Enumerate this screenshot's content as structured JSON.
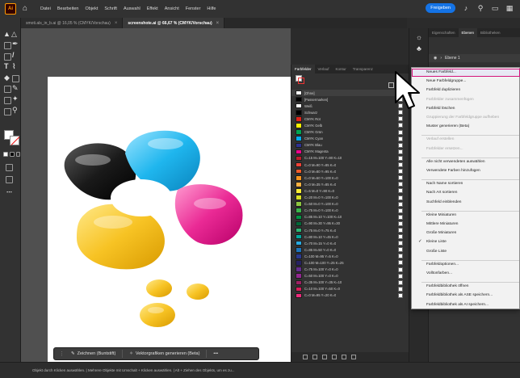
{
  "menubar": {
    "logo": "Ai",
    "items": [
      "Datei",
      "Bearbeiten",
      "Objekt",
      "Schrift",
      "Auswahl",
      "Effekt",
      "Ansicht",
      "Fenster",
      "Hilfe"
    ],
    "share_label": "Freigeben"
  },
  "doc_tabs": [
    {
      "label": "smoti.als_in_b.ai @ 16,05 % (CMYK/Vorschau)",
      "active": false
    },
    {
      "label": "screenshote.ai @ 66,67 % (CMYK/Vorschau)",
      "active": true
    }
  ],
  "swatches_panel": {
    "tabs": [
      "Farbfelder",
      "Verlauf",
      "Kontur",
      "Transparenz"
    ],
    "items": [
      {
        "name": "[Ohne]",
        "color": "#ffffff"
      },
      {
        "name": "[Passermarken]",
        "color": "#000000"
      },
      {
        "name": "Weiß",
        "color": "#ffffff"
      },
      {
        "name": "Schwarz",
        "color": "#000000"
      },
      {
        "name": "CMYK Rot",
        "color": "#e2231a"
      },
      {
        "name": "CMYK Gelb",
        "color": "#fff200"
      },
      {
        "name": "CMYK Grün",
        "color": "#00a651"
      },
      {
        "name": "CMYK Cyan",
        "color": "#00aeef"
      },
      {
        "name": "CMYK Blau",
        "color": "#2e3192"
      },
      {
        "name": "CMYK Magenta",
        "color": "#ec008c"
      },
      {
        "name": "C=15 M=100 Y=90 K=10",
        "color": "#be1e2d"
      },
      {
        "name": "C=0 M=90 Y=85 K=0",
        "color": "#ef4136"
      },
      {
        "name": "C=0 M=80 Y=95 K=0",
        "color": "#f15a29"
      },
      {
        "name": "C=0 M=50 Y=100 K=0",
        "color": "#f7941d"
      },
      {
        "name": "C=0 M=35 Y=85 K=0",
        "color": "#fbb040"
      },
      {
        "name": "C=5 M=0 Y=90 K=0",
        "color": "#f9ed32"
      },
      {
        "name": "C=20 M=0 Y=100 K=0",
        "color": "#d7df23"
      },
      {
        "name": "C=50 M=0 Y=100 K=0",
        "color": "#8dc63f"
      },
      {
        "name": "C=75 M=0 Y=100 K=0",
        "color": "#39b54a"
      },
      {
        "name": "C=85 M=10 Y=100 K=10",
        "color": "#009444"
      },
      {
        "name": "C=90 M=30 Y=95 K=30",
        "color": "#006838"
      },
      {
        "name": "C=75 M=0 Y=75 K=0",
        "color": "#2bb673"
      },
      {
        "name": "C=80 M=10 Y=45 K=0",
        "color": "#00a79d"
      },
      {
        "name": "C=70 M=15 Y=0 K=0",
        "color": "#27aae1"
      },
      {
        "name": "C=85 M=50 Y=0 K=0",
        "color": "#1c75bc"
      },
      {
        "name": "C=100 M=95 Y=5 K=0",
        "color": "#2b3990"
      },
      {
        "name": "C=100 M=100 Y=25 K=25",
        "color": "#262262"
      },
      {
        "name": "C=75 M=100 Y=0 K=0",
        "color": "#662d91"
      },
      {
        "name": "C=50 M=100 Y=0 K=0",
        "color": "#92278f"
      },
      {
        "name": "C=35 M=100 Y=35 K=10",
        "color": "#9e1f63"
      },
      {
        "name": "C=10 M=100 Y=50 K=0",
        "color": "#da1c5c"
      },
      {
        "name": "C=0 M=95 Y=20 K=0",
        "color": "#ee2a7b"
      }
    ]
  },
  "layers_panel": {
    "tabs": [
      "Eigenschaften",
      "Ebenen",
      "Bibliotheken"
    ],
    "layer_name": "Ebene 1"
  },
  "context_menu": {
    "items": [
      {
        "label": "Neues Farbfeld...",
        "enabled": true,
        "highlighted": true
      },
      {
        "label": "Neue Farbfeldgruppe...",
        "enabled": true
      },
      {
        "label": "Farbfeld duplizieren",
        "enabled": true
      },
      {
        "label": "Farbfelder zusammenfügen",
        "enabled": false
      },
      {
        "label": "Farbfeld löschen",
        "enabled": true
      },
      {
        "label": "Gruppierung der Farbfeldgruppe aufheben",
        "enabled": false
      },
      {
        "label": "Muster generieren (Beta)",
        "enabled": true
      },
      {
        "label": "Verlauf erstellen",
        "enabled": false,
        "sep_before": true
      },
      {
        "label": "Farbfelder ersetzen...",
        "enabled": false
      },
      {
        "label": "Alle nicht verwendeten auswählen",
        "enabled": true,
        "sep_before": true
      },
      {
        "label": "Verwendete Farben hinzufügen",
        "enabled": true
      },
      {
        "label": "Nach Name sortieren",
        "enabled": true,
        "sep_before": true
      },
      {
        "label": "Nach Art sortieren",
        "enabled": true
      },
      {
        "label": "Suchfeld einblenden",
        "enabled": true
      },
      {
        "label": "Kleine Miniaturen",
        "enabled": true,
        "sep_before": true
      },
      {
        "label": "Mittlere Miniaturen",
        "enabled": true
      },
      {
        "label": "Große Miniaturen",
        "enabled": true
      },
      {
        "label": "Kleine Liste",
        "enabled": true,
        "checked": true
      },
      {
        "label": "Große Liste",
        "enabled": true
      },
      {
        "label": "Farbfeldoptionen...",
        "enabled": true,
        "sep_before": true
      },
      {
        "label": "Volltonfarben...",
        "enabled": true
      },
      {
        "label": "Farbfeldbibliothek öffnen",
        "enabled": true,
        "sep_before": true
      },
      {
        "label": "Farbfeldbibliothek als ASE speichern...",
        "enabled": true
      },
      {
        "label": "Farbfeldbibliothek als AI speichern...",
        "enabled": true
      }
    ]
  },
  "taskbar": {
    "draw_label": "Zeichnen (Buntstift)",
    "vector_label": "Vektorgrafiken generieren (Beta)",
    "more_label": "•••"
  },
  "statusbar": {
    "text": "Objekt durch Klicken auswählen. | Mehrere Objekte mit Umschalt + Klicken auswählen. | Alt + Ziehen des Objekts, um es zu..."
  },
  "colors": {
    "accent_blue": "#1473e6",
    "highlight_magenta": "#d4147b"
  }
}
